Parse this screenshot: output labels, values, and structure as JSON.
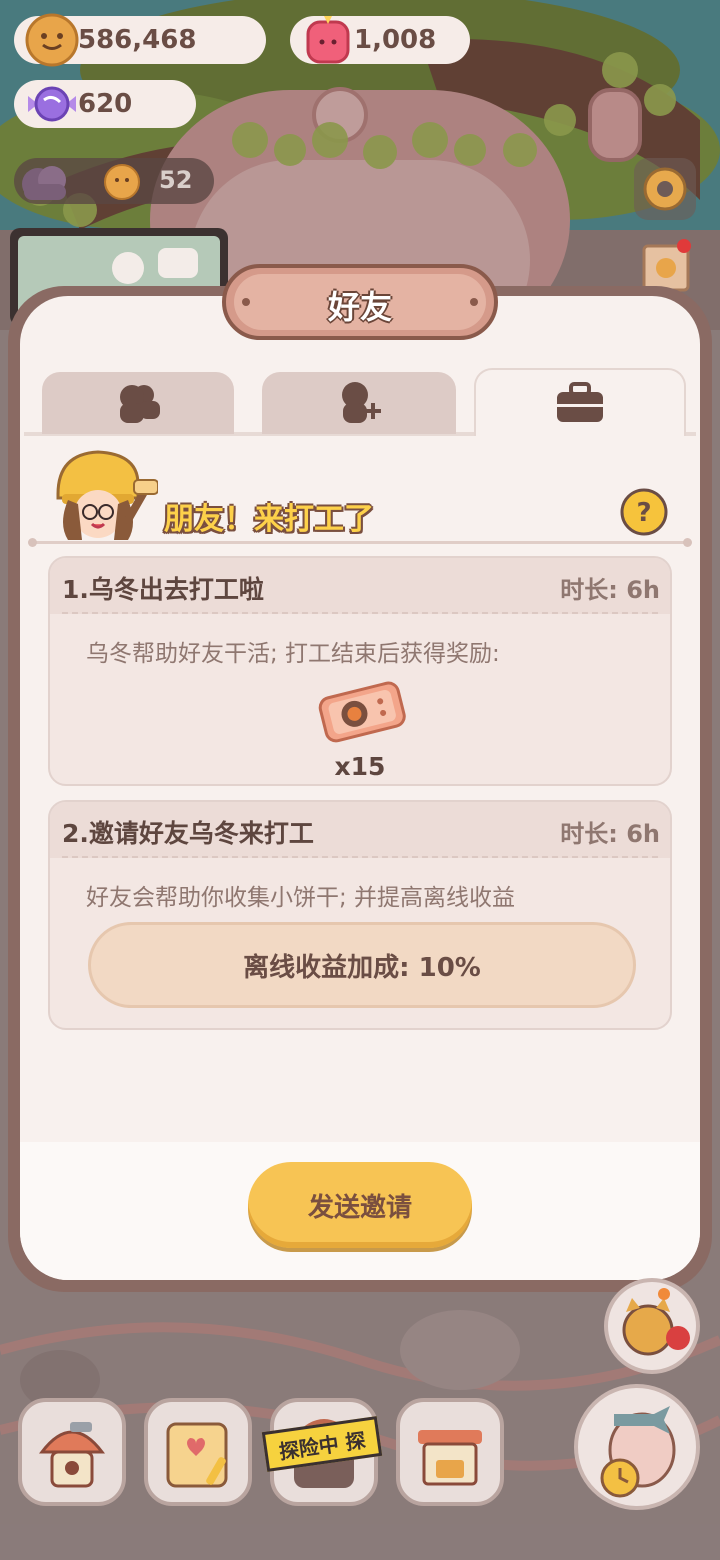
{
  "top_bar": {
    "cookies": "586,468",
    "gems": "1,008",
    "candies": "620",
    "friend_count": "52"
  },
  "modal": {
    "title": "好友",
    "tabs": [
      {
        "icon": "friends-icon"
      },
      {
        "icon": "add-friend-icon"
      },
      {
        "icon": "briefcase-icon",
        "active": true
      }
    ],
    "headline": "朋友！来打工了",
    "cards": [
      {
        "title": "1.乌冬出去打工啦",
        "duration": "时长: 6h",
        "description": "乌冬帮助好友干活; 打工结束后获得奖励:",
        "reward_count": "x15"
      },
      {
        "title": "2.邀请好友乌冬来打工",
        "duration": "时长: 6h",
        "description": "好友会帮助你收集小饼干; 并提高离线收益",
        "bonus": "离线收益加成: 10%"
      }
    ],
    "send_button": "发送邀请"
  },
  "bottom_nav": {
    "explore_tape": "探险中 探"
  },
  "colors": {
    "accent_yellow": "#f7c454",
    "frame_brown": "#8a6a63",
    "panel_bg": "#f8f1ee"
  }
}
